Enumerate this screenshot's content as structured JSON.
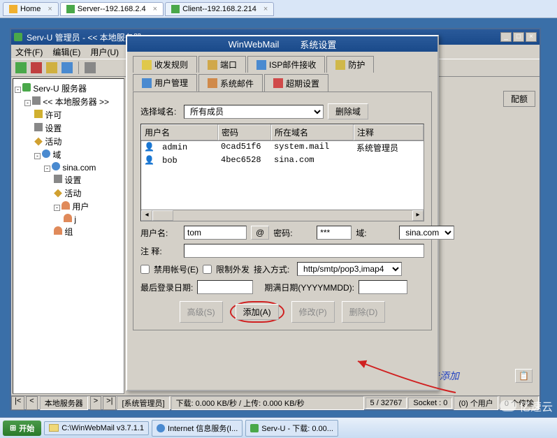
{
  "browser_tabs": [
    {
      "label": "Home",
      "close": "×"
    },
    {
      "label": "Server--192.168.2.4",
      "close": "×",
      "active": true
    },
    {
      "label": "Client--192.168.2.214",
      "close": "×"
    }
  ],
  "servu": {
    "title": "Serv-U 管理员 - << 本地服务器 >>",
    "menus": [
      "文件(F)",
      "编辑(E)",
      "用户(U)"
    ],
    "winbtns": {
      "min": "_",
      "max": "□",
      "close": "×"
    },
    "tree": {
      "root": "Serv-U 服务器",
      "local": "<< 本地服务器 >>",
      "permit": "许可",
      "settings": "设置",
      "activity": "活动",
      "domains": "域",
      "domain_name": "sina.com",
      "d_settings": "设置",
      "d_activity": "活动",
      "d_users": "用户",
      "user_j": "j",
      "d_groups": "组"
    },
    "right_tab": "配额",
    "status": {
      "nav": {
        "first": "|<",
        "prev": "<",
        "sep": "",
        "next": ">",
        "last": ">|"
      },
      "cell1": "本地服务器",
      "cell2": "[系统管理员]",
      "cell3": "下载: 0.000 KB/秒 / 上传: 0.000 KB/秒",
      "cell4": "5 / 32767",
      "cell5": "Socket : 0",
      "cell6": "(0) 个用户",
      "cell7": "0 个传输"
    }
  },
  "dlg": {
    "title_app": "WinWebMail",
    "title_sec": "系统设置",
    "tabs_top": [
      "收发规则",
      "端口",
      "ISP邮件接收",
      "防护"
    ],
    "tabs_bot": [
      "用户管理",
      "系统邮件",
      "超期设置"
    ],
    "active_tab": "用户管理",
    "select_domain_label": "选择域名:",
    "select_domain_value": "所有成员",
    "del_domain": "删除域",
    "grid": {
      "cols": [
        "用户名",
        "密码",
        "所在域名",
        "注释"
      ],
      "rows": [
        {
          "user": "admin",
          "pwd": "0cad51f6",
          "domain": "system.mail",
          "note": "系统管理员"
        },
        {
          "user": "bob",
          "pwd": "4bec6528",
          "domain": "sina.com",
          "note": ""
        }
      ]
    },
    "f_user_label": "用户名:",
    "f_user_value": "tom",
    "f_at": "@",
    "f_pwd_label": "密码:",
    "f_pwd_value": "***",
    "f_domain_label": "域:",
    "f_domain_value": "sina.com",
    "f_note_label": "注  释:",
    "f_note_value": "",
    "cb_disable": "禁用帐号(E)",
    "cb_limit": "限制外发",
    "conn_label": "接入方式:",
    "conn_value": "http/smtp/pop3,imap4",
    "lastlogin_label": "最后登录日期:",
    "lastlogin_value": "",
    "expire_label": "期满日期(YYYYMMDD):",
    "expire_value": "",
    "btn_adv": "高级(S)",
    "btn_add": "添加(A)",
    "btn_mod": "修改(P)",
    "btn_del": "删除(D)"
  },
  "annotation": "一定要点击添加",
  "taskbar": {
    "start": "开始",
    "items": [
      "C:\\WinWebMail v3.7.1.1",
      "Internet 信息服务(I...",
      "Serv-U - 下载: 0.00..."
    ]
  },
  "watermark": "亿速云"
}
